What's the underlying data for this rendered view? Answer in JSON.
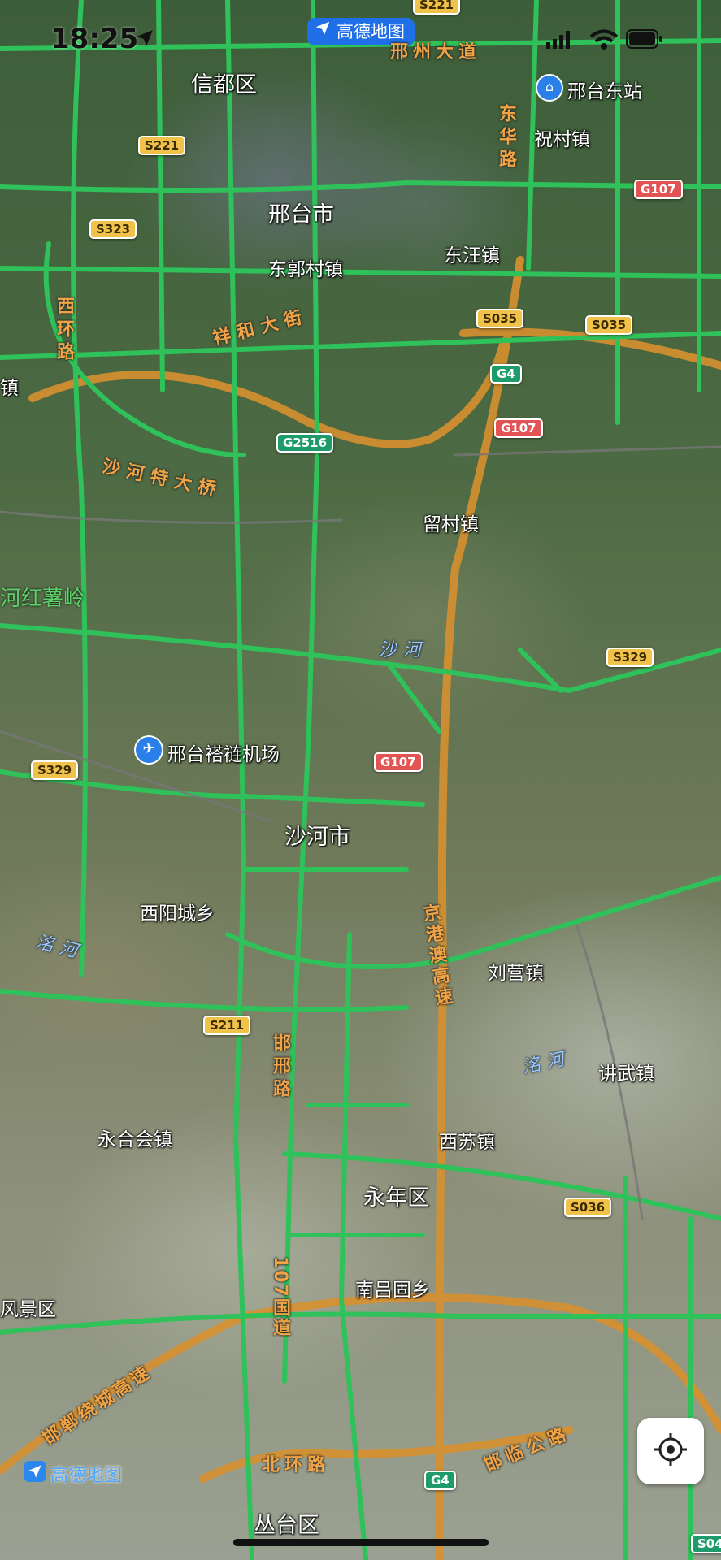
{
  "status_bar": {
    "time": "18:25"
  },
  "app_badge": {
    "label": "高德地图"
  },
  "watermark": {
    "label": "高德地图"
  },
  "cities": {
    "xindu": "信都区",
    "xingtai": "邢台市",
    "shahe": "沙河市",
    "yongnian": "永年区",
    "congtai": "丛台区"
  },
  "towns": {
    "zhucun": "祝村镇",
    "dongwang": "东汪镇",
    "dongguocun": "东郭村镇",
    "liucun": "留村镇",
    "xiyangcheng": "西阳城乡",
    "liuying": "刘营镇",
    "jiangwu": "讲武镇",
    "xisu": "西苏镇",
    "yonghehui": "永合会镇",
    "nanlvgu": "南吕固乡",
    "fengjingqu": "风景区",
    "zhen_left": "镇"
  },
  "pois": {
    "xingtai_east_station": "邢台东站",
    "airport": "邢台褡裢机场",
    "hongshuling": "河红薯岭"
  },
  "road_names": {
    "xingzhou": "邢州大道",
    "donghua": "东华路",
    "xihuan": "西环路",
    "xianghe": "祥和大街",
    "shahe_bridge": "沙河特大桥",
    "jinggangao": "京港澳高速",
    "hanxing": "邯邢路",
    "g107": "107国道",
    "handan_ring": "邯郸绕城高速",
    "huanbei": "北环路",
    "hanlin": "邯临公路"
  },
  "rivers": {
    "shahe_river": "沙河",
    "minghe_west": "洺河",
    "minghe_east": "洺河"
  },
  "shields": {
    "s221_top": "S221",
    "s221": "S221",
    "s323": "S323",
    "g107_ne": "G107",
    "s035_a": "S035",
    "s035_b": "S035",
    "g4_a": "G4",
    "g107_mid": "G107",
    "g2516": "G2516",
    "s329_e": "S329",
    "s329_w": "S329",
    "g107_shahe": "G107",
    "s211": "S211",
    "s036": "S036",
    "g4_b": "G4",
    "s04": "S04"
  },
  "colors": {
    "road": "#2fc15a",
    "road_casing": "#f0a445",
    "badge": "#1f6fe8"
  },
  "icons": {
    "location": "location-arrow-icon",
    "locate": "locate-crosshair-icon"
  }
}
